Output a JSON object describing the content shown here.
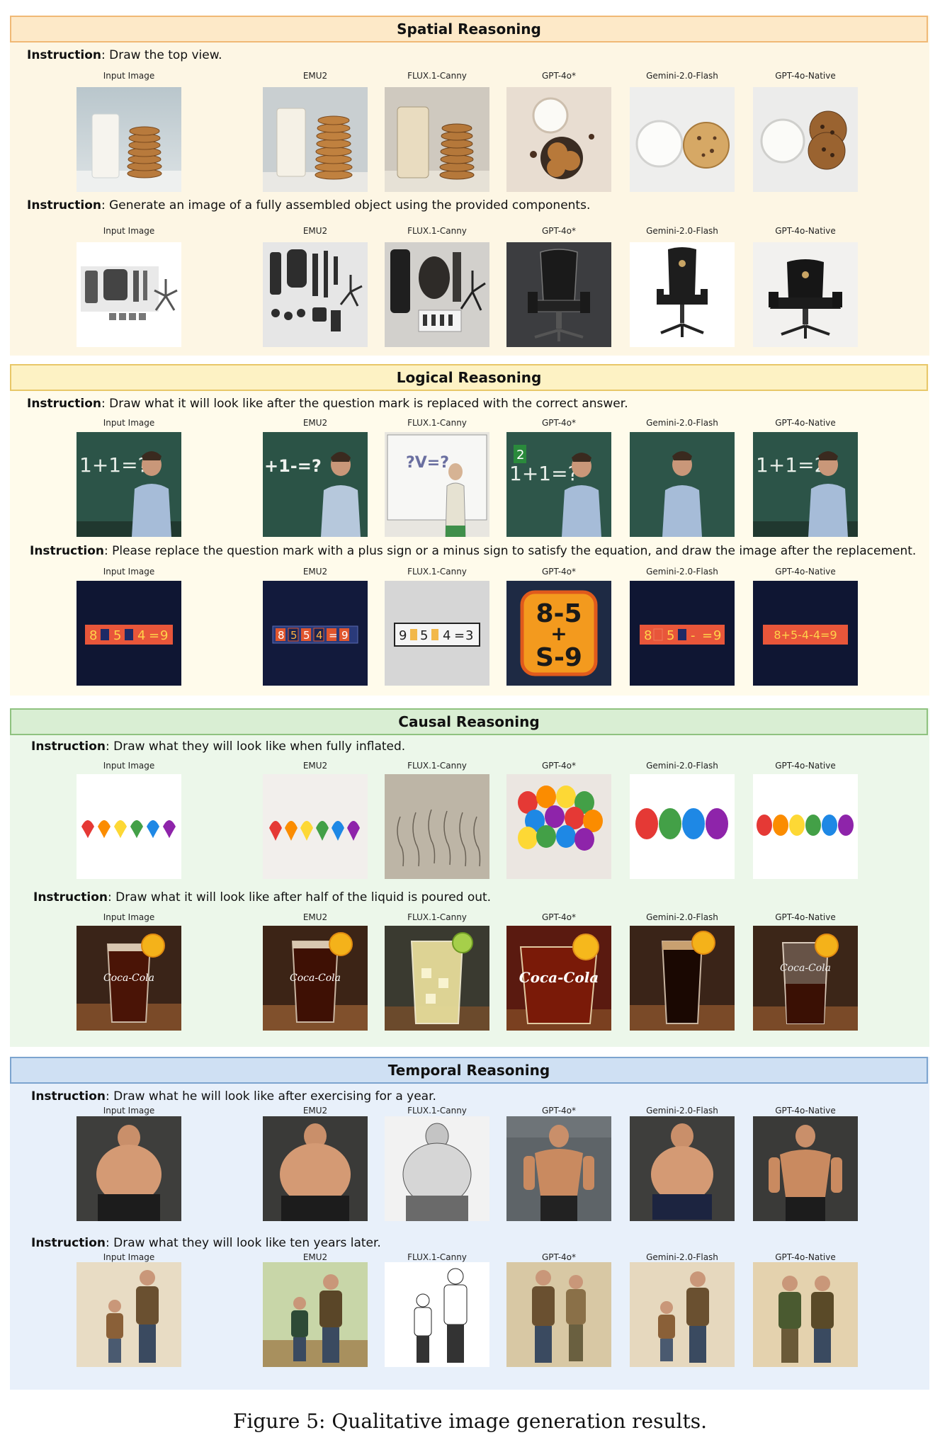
{
  "caption": "Figure 5: Qualitative image generation results.",
  "column_labels": [
    "Input Image",
    "EMU2",
    "FLUX.1-Canny",
    "GPT-4o*",
    "Gemini-2.0-Flash",
    "GPT-4o-Native"
  ],
  "sections": [
    {
      "title": "Spatial Reasoning",
      "rows": [
        {
          "instruction_key": "Instruction",
          "instruction_text": ": Draw the top view."
        },
        {
          "instruction_key": "Instruction",
          "instruction_text": ": Generate an image of a fully assembled object using the provided components."
        }
      ]
    },
    {
      "title": "Logical Reasoning",
      "rows": [
        {
          "instruction_key": "Instruction",
          "instruction_text": ": Draw what it will look like after the question mark is replaced with the correct answer."
        },
        {
          "instruction_key": "Instruction",
          "instruction_text": ": Please replace the question mark with a plus sign or a minus sign to satisfy the equation, and draw the image after the replacement."
        }
      ]
    },
    {
      "title": "Causal Reasoning",
      "rows": [
        {
          "instruction_key": "Instruction",
          "instruction_text": ": Draw what they will look like when fully inflated."
        },
        {
          "instruction_key": "Instruction",
          "instruction_text": ": Draw what it will look like after half of the liquid is poured out."
        }
      ]
    },
    {
      "title": "Temporal Reasoning",
      "rows": [
        {
          "instruction_key": "Instruction",
          "instruction_text": ": Draw what he will look like after exercising for a year."
        },
        {
          "instruction_key": "Instruction",
          "instruction_text": ": Draw what they will look like ten years later."
        }
      ]
    }
  ],
  "image_text": {
    "chalk_input": "1+1=?",
    "chalk_emu2": "+1-=?",
    "chalk_flux": "?V=?",
    "chalk_gpt4o": "1+1=?",
    "chalk_gpt4o_badge": "2",
    "chalk_native": "1+1=2",
    "eq_input": [
      "8",
      "5",
      "4",
      "=",
      "9"
    ],
    "eq_emu2": [
      "8",
      "5",
      "5",
      "4",
      "=",
      "9"
    ],
    "eq_flux": [
      "9",
      "5",
      "4",
      "=",
      "3"
    ],
    "eq_gpt4o_top": "8-5",
    "eq_gpt4o_mid": "+",
    "eq_gpt4o_bot": "S-9",
    "eq_gemini": [
      "8",
      "5",
      "-",
      "=",
      "9"
    ],
    "eq_native": "8+5-4-4=9",
    "coke_brand": "Coca-Cola"
  },
  "colors": {
    "balloons": [
      "#e53935",
      "#fb8c00",
      "#fdd835",
      "#43a047",
      "#1e88e5",
      "#8e24aa"
    ]
  }
}
